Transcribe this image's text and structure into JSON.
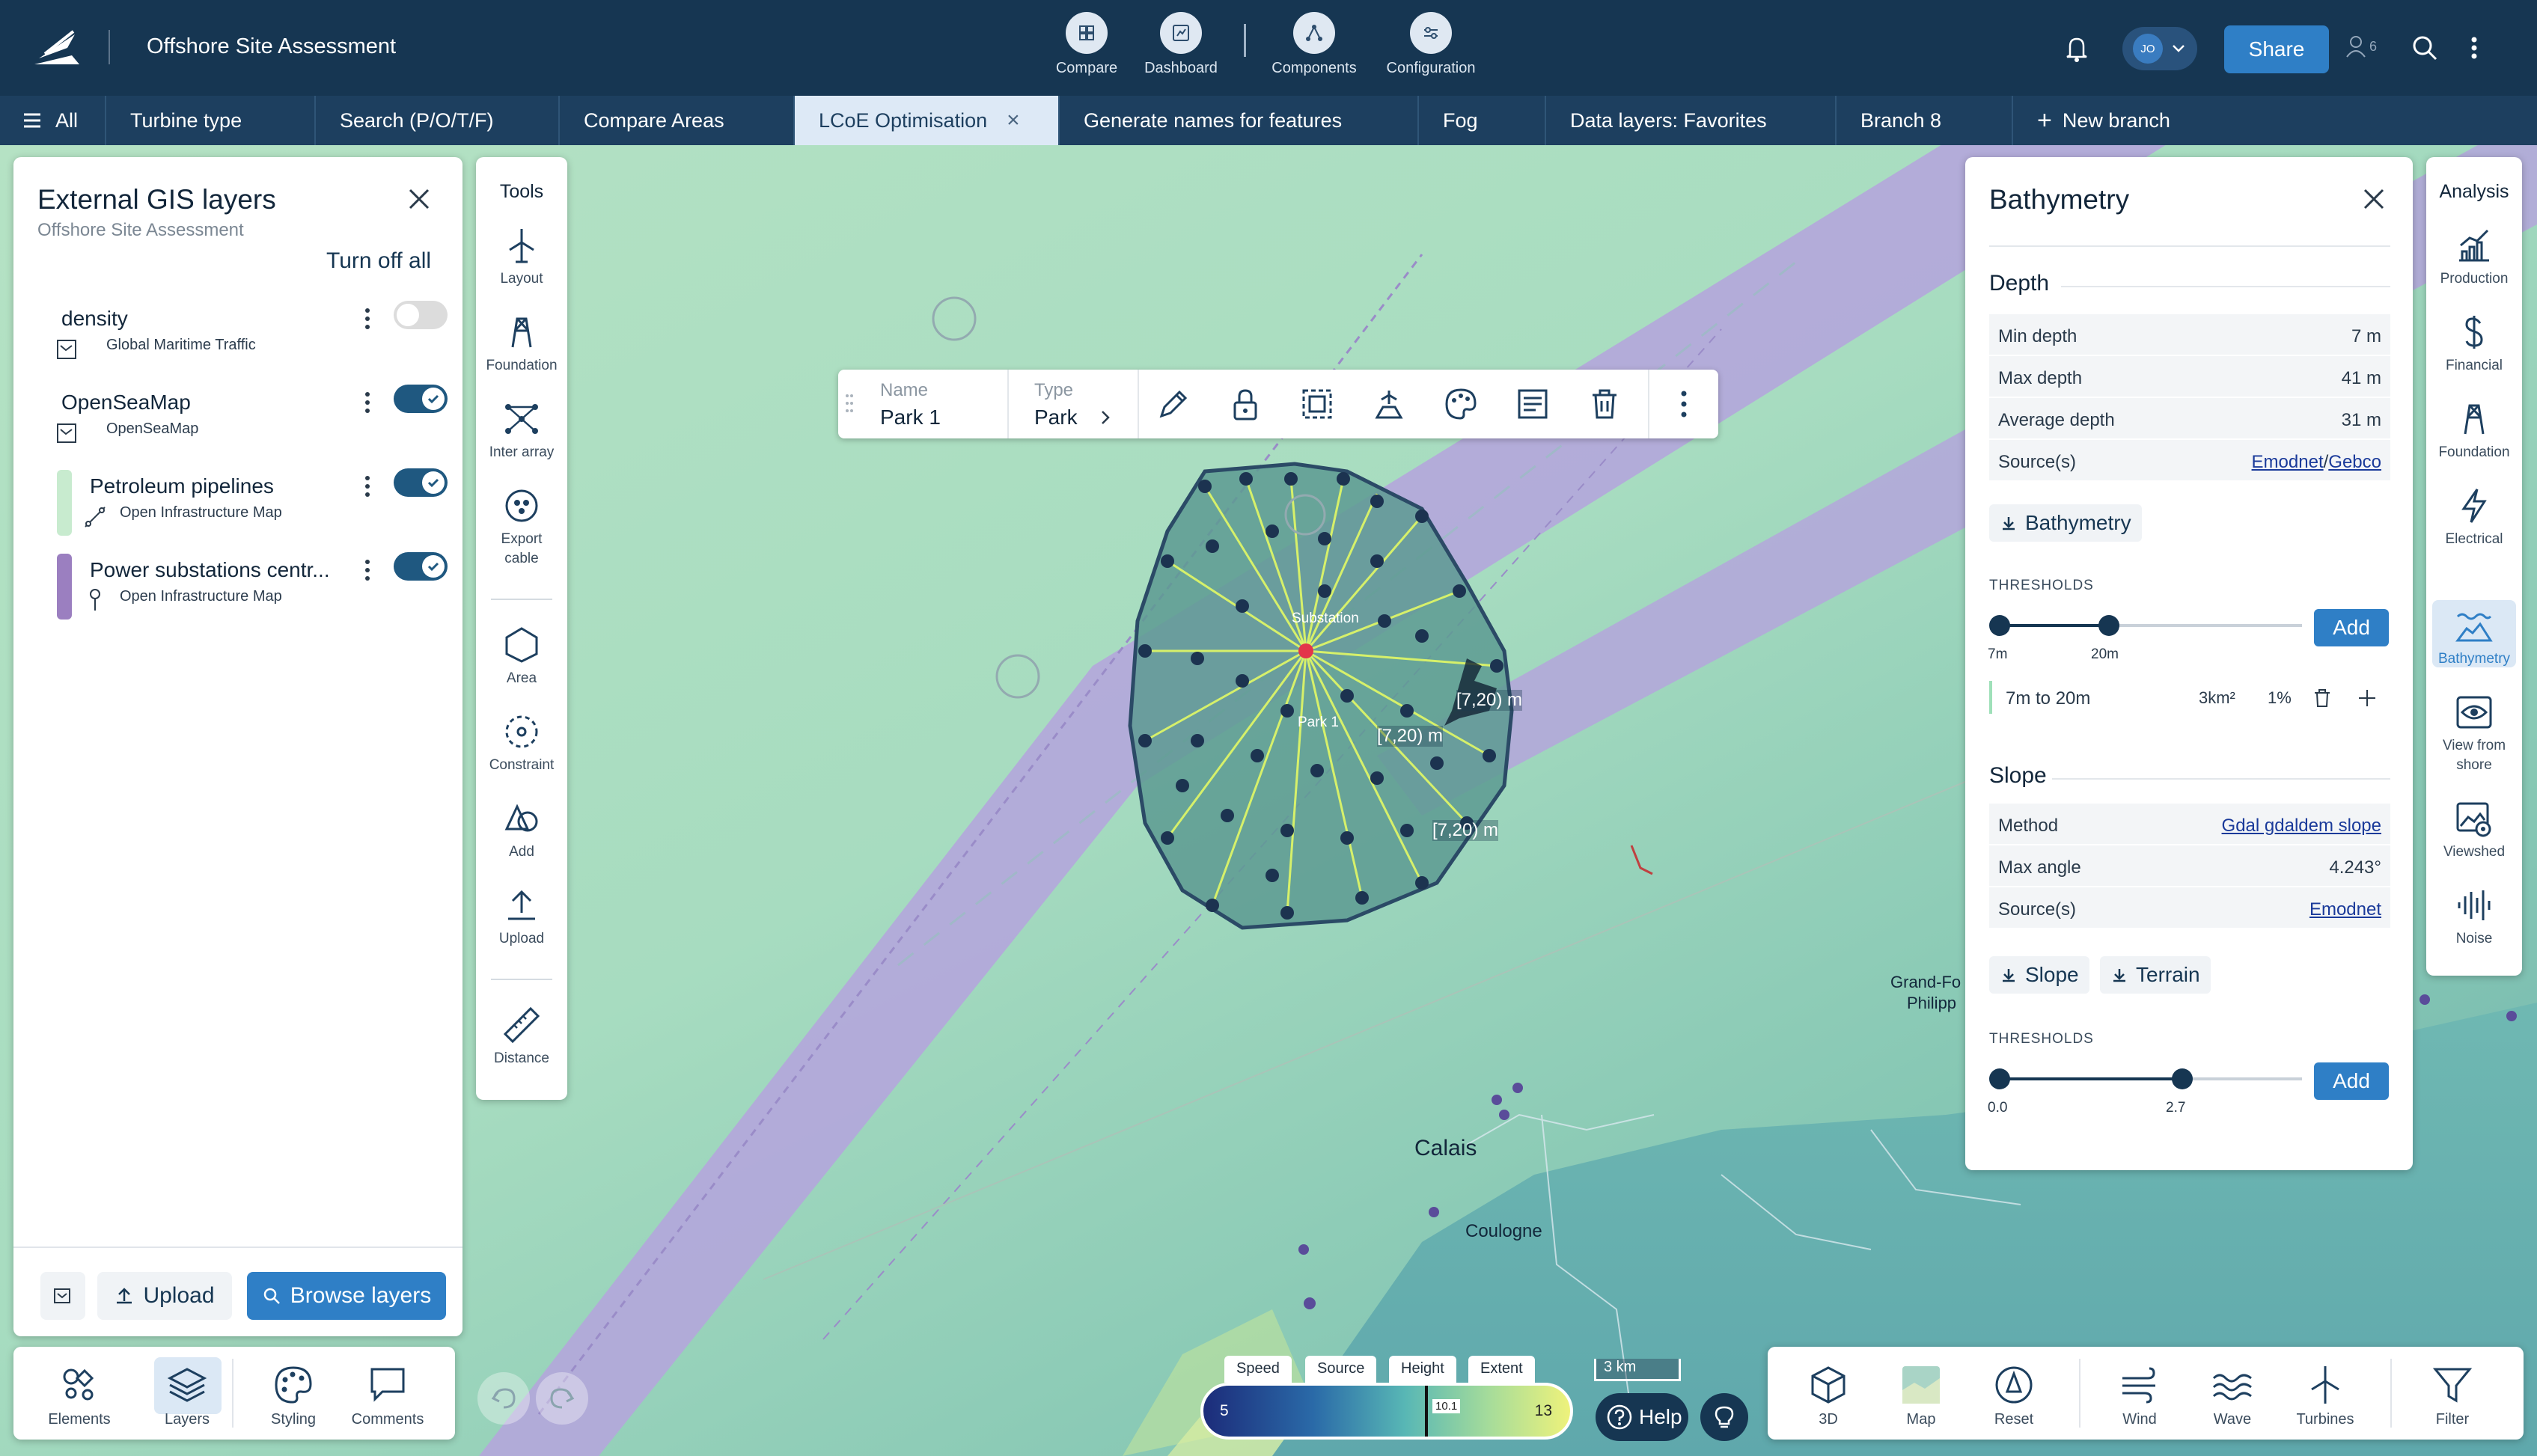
{
  "app": {
    "title": "Offshore Site Assessment",
    "accent": "#163652",
    "share_label": "Share",
    "avatar_initials": "JO",
    "user_count": "6"
  },
  "top_nav": [
    {
      "label": "Compare",
      "icon": "compare-icon"
    },
    {
      "label": "Dashboard",
      "icon": "dashboard-icon"
    },
    {
      "label": "Components",
      "icon": "components-icon"
    },
    {
      "label": "Configuration",
      "icon": "configuration-icon"
    }
  ],
  "tabs": [
    {
      "label": "All"
    },
    {
      "label": "Turbine type"
    },
    {
      "label": "Search (P/O/T/F)"
    },
    {
      "label": "Compare Areas"
    },
    {
      "label": "LCoE Optimisation",
      "active": true
    },
    {
      "label": "Generate names for features"
    },
    {
      "label": "Fog"
    },
    {
      "label": "Data layers: Favorites"
    },
    {
      "label": "Branch 8"
    },
    {
      "label": "New branch"
    }
  ],
  "gis_panel": {
    "title": "External GIS layers",
    "subtitle": "Offshore Site Assessment",
    "turn_off_all": "Turn off all",
    "layers": [
      {
        "name": "density",
        "source": "Global Maritime Traffic",
        "enabled": false,
        "color": ""
      },
      {
        "name": "OpenSeaMap",
        "source": "OpenSeaMap",
        "enabled": true,
        "color": ""
      },
      {
        "name": "Petroleum pipelines",
        "source": "Open Infrastructure Map",
        "enabled": true,
        "color": "#c8ebcf"
      },
      {
        "name": "Power substations centr...",
        "source": "Open Infrastructure Map",
        "enabled": true,
        "color": "#9b7fc0"
      }
    ],
    "upload_label": "Upload",
    "browse_label": "Browse layers"
  },
  "tools": {
    "title": "Tools",
    "items": [
      "Layout",
      "Foundation",
      "Inter array",
      "Export cable",
      "Area",
      "Constraint",
      "Add",
      "Upload",
      "Distance"
    ]
  },
  "bottom_left": [
    "Elements",
    "Layers",
    "Styling",
    "Comments"
  ],
  "feature_bar": {
    "name_label": "Name",
    "name_value": "Park 1",
    "type_label": "Type",
    "type_value": "Park"
  },
  "map": {
    "labels": {
      "substation": "Substation",
      "park": "Park 1",
      "depth_a": "[7,20) m",
      "depth_b": "[7,20) m",
      "depth_c": "[7,20) m",
      "calais": "Calais",
      "coulogne": "Coulogne",
      "grand_fort": "Grand-Fo",
      "philippe": "Philipp"
    },
    "legend_tabs": [
      "Speed",
      "Source",
      "Height",
      "Extent"
    ],
    "legend_min": "5",
    "legend_mid": "10.1",
    "legend_max": "13",
    "scale": "3 km",
    "help_label": "Help"
  },
  "bathymetry": {
    "title": "Bathymetry",
    "depth_title": "Depth",
    "depth_rows": [
      {
        "k": "Min depth",
        "v": "7 m"
      },
      {
        "k": "Max depth",
        "v": "41 m"
      },
      {
        "k": "Average depth",
        "v": "31 m"
      }
    ],
    "depth_source_label": "Source(s)",
    "depth_source_a": "Emodnet",
    "depth_source_sep": "/",
    "depth_source_b": "Gebco",
    "download_depth": "Bathymetry",
    "thresholds_label": "THRESHOLDS",
    "add_label": "Add",
    "depth_thr_low": "7m",
    "depth_thr_high": "20m",
    "range_label": "7m to 20m",
    "range_area": "3km²",
    "range_pct": "1%",
    "slope_title": "Slope",
    "slope_rows": [
      {
        "k": "Method",
        "v": "Gdal gdaldem slope",
        "link": true
      },
      {
        "k": "Max angle",
        "v": "4.243°",
        "link": false
      },
      {
        "k": "Source(s)",
        "v": "Emodnet",
        "link": true
      }
    ],
    "download_slope": "Slope",
    "download_terrain": "Terrain",
    "slope_thr_low": "0.0",
    "slope_thr_high": "2.7"
  },
  "analysis": {
    "title": "Analysis",
    "items": [
      "Production",
      "Financial",
      "Foundation",
      "Electrical",
      "Bathymetry",
      "View from shore",
      "Viewshed",
      "Noise"
    ]
  },
  "bottom_right": [
    "3D",
    "Map",
    "Reset",
    "Wind",
    "Wave",
    "Turbines",
    "Filter"
  ]
}
